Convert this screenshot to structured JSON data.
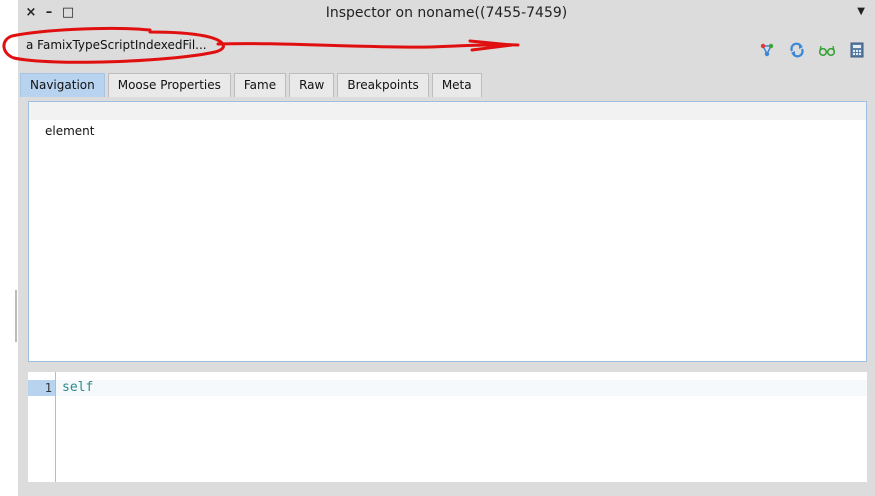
{
  "window": {
    "title": "Inspector on noname((7455-7459)",
    "close_glyph": "×",
    "minimize_glyph": "–",
    "maximize_glyph": "□",
    "menu_glyph": "▼"
  },
  "inspector": {
    "object_label": "a FamixTypeScriptIndexedFil...",
    "toolbar_icons": [
      "tree-graph-icon",
      "refresh-icon",
      "glasses-icon",
      "calculator-icon"
    ]
  },
  "tabs": [
    {
      "label": "Navigation",
      "active": true
    },
    {
      "label": "Moose Properties",
      "active": false
    },
    {
      "label": "Fame",
      "active": false
    },
    {
      "label": "Raw",
      "active": false
    },
    {
      "label": "Breakpoints",
      "active": false
    },
    {
      "label": "Meta",
      "active": false
    }
  ],
  "navigation": {
    "items": [
      "element"
    ]
  },
  "code_editor": {
    "line_number": "1",
    "code": "self"
  },
  "colors": {
    "active_tab": "#b8d3ef",
    "code_text": "#2a8b8b",
    "annotation": "#e01010",
    "icon_blue": "#3a87d6",
    "icon_green": "#3aa33a"
  }
}
